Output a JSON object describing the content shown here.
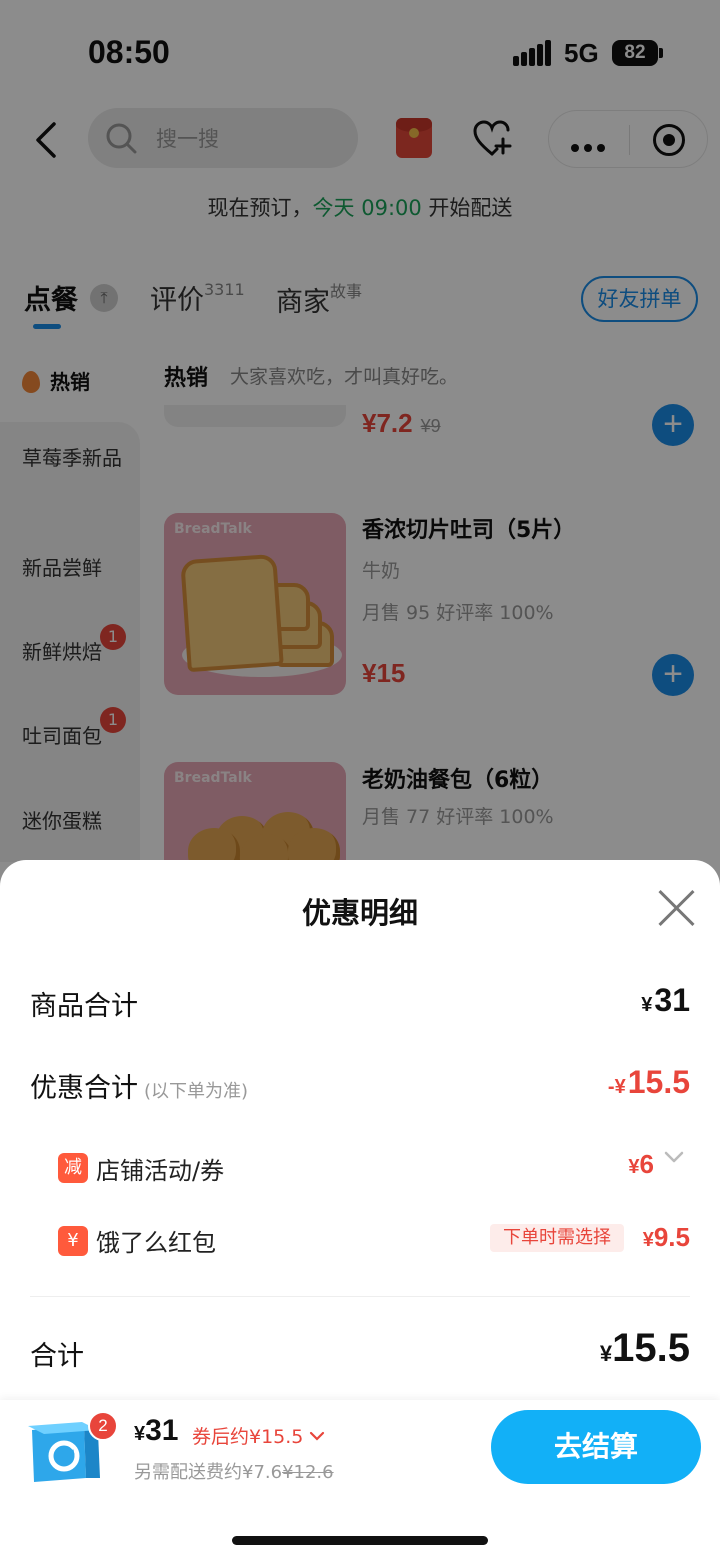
{
  "status_bar": {
    "time": "08:50",
    "network": "5G",
    "battery": "82"
  },
  "nav": {
    "search_placeholder": "搜一搜"
  },
  "notice": {
    "prefix": "现在预订，",
    "highlight": "今天 09:00",
    "suffix": " 开始配送"
  },
  "tabs": [
    {
      "label": "点餐",
      "sup": ""
    },
    {
      "label": "评价",
      "sup": "3311"
    },
    {
      "label": "商家",
      "sup": "故事"
    }
  ],
  "friend_button": "好友拼单",
  "sidebar": {
    "hot": "热销",
    "items": [
      {
        "label": "草莓季新品",
        "badge": ""
      },
      {
        "label": "新品尝鲜",
        "badge": ""
      },
      {
        "label": "新鲜烘焙",
        "badge": "1"
      },
      {
        "label": "吐司面包",
        "badge": "1"
      },
      {
        "label": "迷你蛋糕",
        "badge": ""
      }
    ]
  },
  "section": {
    "title": "热销",
    "subtitle": "大家喜欢吃，才叫真好吃。"
  },
  "products": [
    {
      "price": "¥7.2",
      "old_price": "¥9"
    },
    {
      "brand": "BreadTalk",
      "name": "香浓切片吐司（5片）",
      "desc": "牛奶",
      "stats": "月售 95 好评率 100%",
      "price": "¥15"
    },
    {
      "brand": "BreadTalk",
      "name": "老奶油餐包（6粒）",
      "stats": "月售 77 好评率 100%"
    }
  ],
  "sheet": {
    "title": "优惠明细",
    "goods_total_label": "商品合计",
    "goods_total": "31",
    "discount_label": "优惠合计",
    "discount_note": "(以下单为准)",
    "discount_total": "15.5",
    "store_icon": "减",
    "store_label": "店铺活动/券",
    "store_amount": "6",
    "redpack_icon": "¥",
    "redpack_label": "饿了么红包",
    "redpack_tag": "下单时需选择",
    "redpack_amount": "9.5",
    "total_label": "合计",
    "total": "15.5"
  },
  "bottom_bar": {
    "cart_count": "2",
    "price": "31",
    "after_coupon": "券后约¥15.5",
    "delivery_prefix": "另需配送费约¥7.6",
    "delivery_old": "¥12.6",
    "checkout": "去结算"
  },
  "colors": {
    "accent_blue": "#1a8ce8",
    "checkout_blue": "#12b0f7",
    "red": "#e8453b",
    "green": "#1ba35a"
  },
  "icons": [
    "back-icon",
    "search-icon",
    "red-packet-icon",
    "heart-plus-icon",
    "more-icon",
    "target-icon",
    "flame-icon",
    "add-icon",
    "close-icon",
    "chevron-down-icon",
    "cart-icon"
  ]
}
